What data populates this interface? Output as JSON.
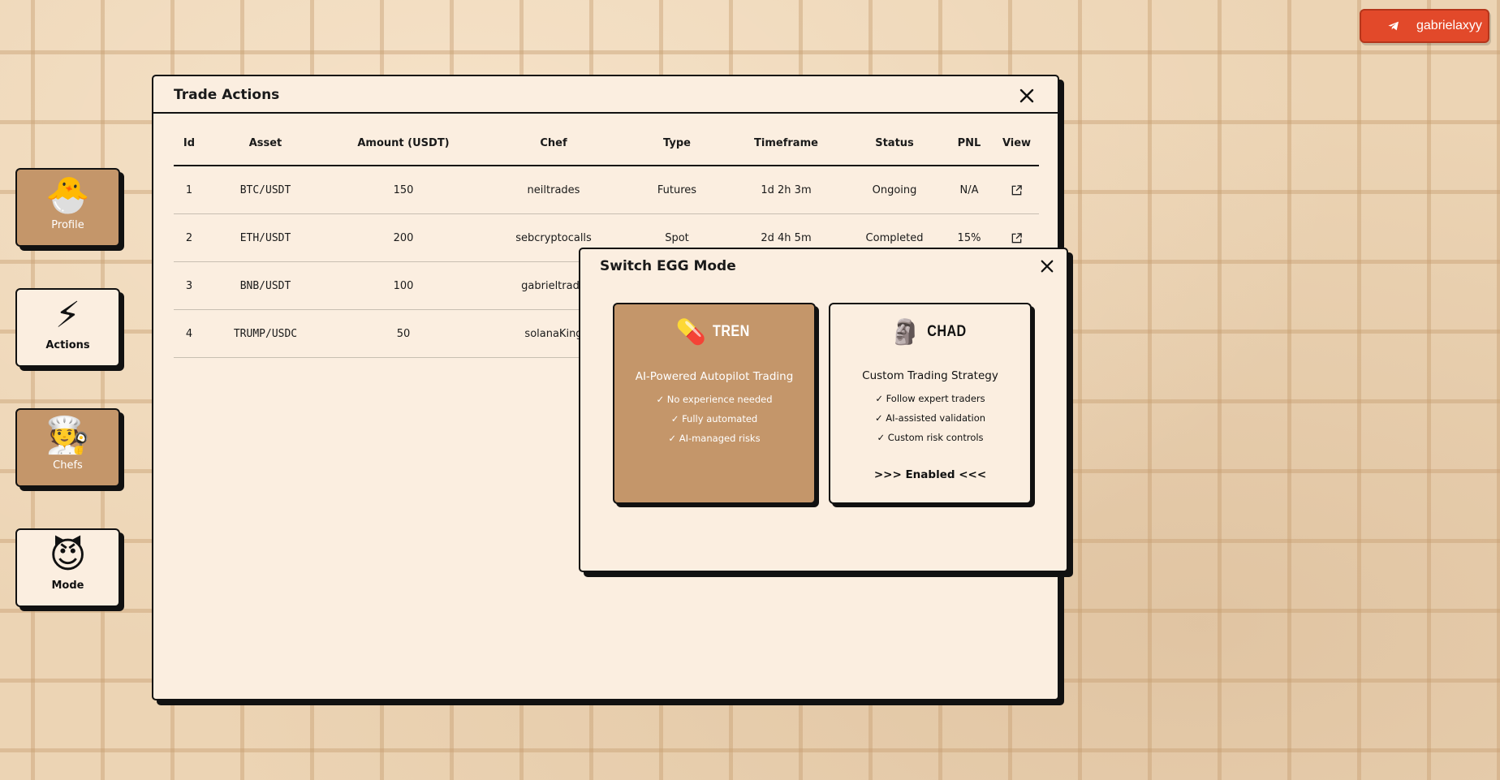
{
  "user": {
    "telegram_handle": "gabrielaxyy"
  },
  "nav": {
    "items": [
      {
        "label": "Profile",
        "emoji": "🐣"
      },
      {
        "label": "Actions",
        "emoji": "⚡"
      },
      {
        "label": "Chefs",
        "emoji": "🧑‍🍳"
      },
      {
        "label": "Mode",
        "emoji": "😈"
      }
    ]
  },
  "trade_panel": {
    "title": "Trade Actions",
    "columns": [
      "Id",
      "Asset",
      "Amount (USDT)",
      "Chef",
      "Type",
      "Timeframe",
      "Status",
      "PNL",
      "View"
    ],
    "rows": [
      {
        "id": "1",
        "asset": "BTC/USDT",
        "amount": "150",
        "chef": "neiltrades",
        "type": "Futures",
        "timeframe": "1d 2h 3m",
        "status": "Ongoing",
        "pnl": "N/A"
      },
      {
        "id": "2",
        "asset": "ETH/USDT",
        "amount": "200",
        "chef": "sebcryptocalls",
        "type": "Spot",
        "timeframe": "2d 4h 5m",
        "status": "Completed",
        "pnl": "15%"
      },
      {
        "id": "3",
        "asset": "BNB/USDT",
        "amount": "100",
        "chef": "gabrieltrade",
        "type": "",
        "timeframe": "",
        "status": "",
        "pnl": ""
      },
      {
        "id": "4",
        "asset": "TRUMP/USDC",
        "amount": "50",
        "chef": "solanaKing",
        "type": "",
        "timeframe": "",
        "status": "",
        "pnl": ""
      }
    ]
  },
  "egg_mode": {
    "title": "Switch EGG Mode",
    "modes": [
      {
        "name": "TREN",
        "emoji": "💊",
        "subtitle": "AI-Powered Autopilot Trading",
        "features": [
          "✓ No experience needed",
          "✓ Fully automated",
          "✓ AI-managed risks"
        ],
        "status": ""
      },
      {
        "name": "CHAD",
        "emoji": "🗿",
        "subtitle": "Custom Trading Strategy",
        "features": [
          "✓ Follow expert traders",
          "✓ AI-assisted validation",
          "✓ Custom risk controls"
        ],
        "status": ">>> Enabled <<<"
      }
    ]
  },
  "colors": {
    "accent_tan": "#c4966a",
    "panel_bg": "#fbeee0",
    "telegram_red": "#e2492a"
  }
}
